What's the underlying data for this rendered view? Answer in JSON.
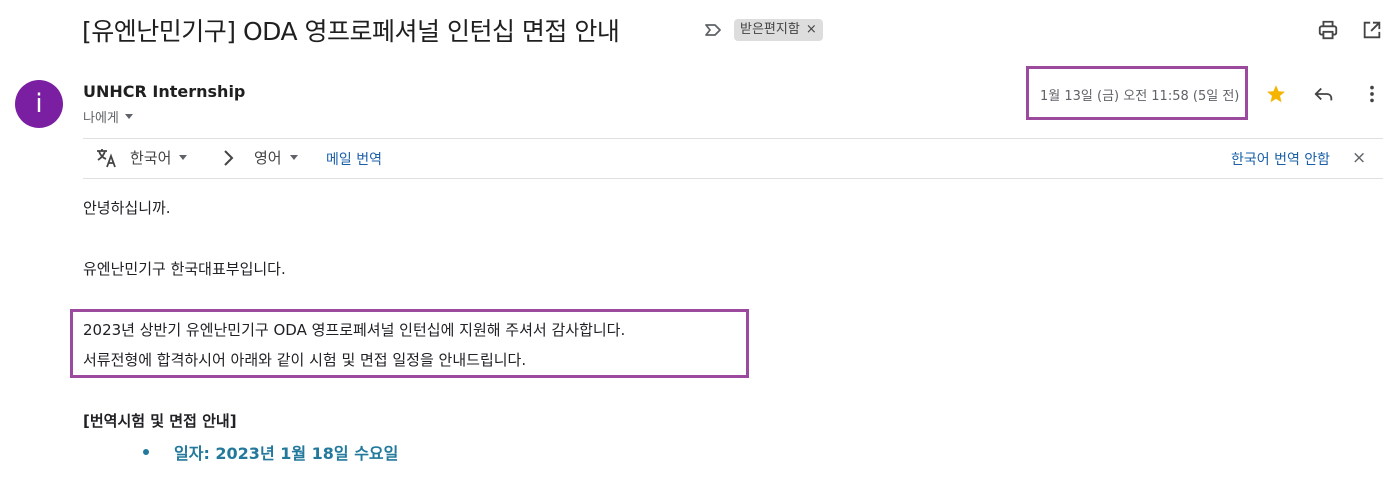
{
  "email": {
    "subject": "[유엔난민기구] ODA 영프로페셔널 인턴십 면접 안내",
    "label": "받은편지함",
    "label_remove": "×",
    "sender_name": "UNHCR Internship",
    "avatar_letter": "i",
    "recipient": "나에게",
    "date": "1월 13일 (금) 오전 11:58 (5일 전)"
  },
  "translate_bar": {
    "source_lang": "한국어",
    "target_lang": "영어",
    "translate_link": "메일 번역",
    "dont_translate": "한국어 번역 안함",
    "close": "×"
  },
  "body": {
    "greeting": "안녕하십니까.",
    "intro": "유엔난민기구 한국대표부입니다.",
    "line1": "2023년 상반기 유엔난민기구 ODA 영프로페셔널 인턴십에 지원해 주셔서 감사합니다.",
    "line2": "서류전형에 합격하시어 아래와 같이 시험 및 면접 일정을 안내드립니다.",
    "section_title": "[번역시험 및 면접 안내]",
    "bullet1": "일자: 2023년 1월 18일 수요일"
  },
  "colors": {
    "avatar": "#7b1fa2",
    "highlight_box": "#9b4a9e",
    "star": "#f4b400",
    "link": "#1a5fa8",
    "bullet": "#23799c"
  },
  "icons": [
    "important-marker-icon",
    "print-icon",
    "open-new-window-icon",
    "star-icon",
    "reply-icon",
    "more-vert-icon",
    "translate-icon",
    "chevron-right-icon",
    "close-icon"
  ]
}
